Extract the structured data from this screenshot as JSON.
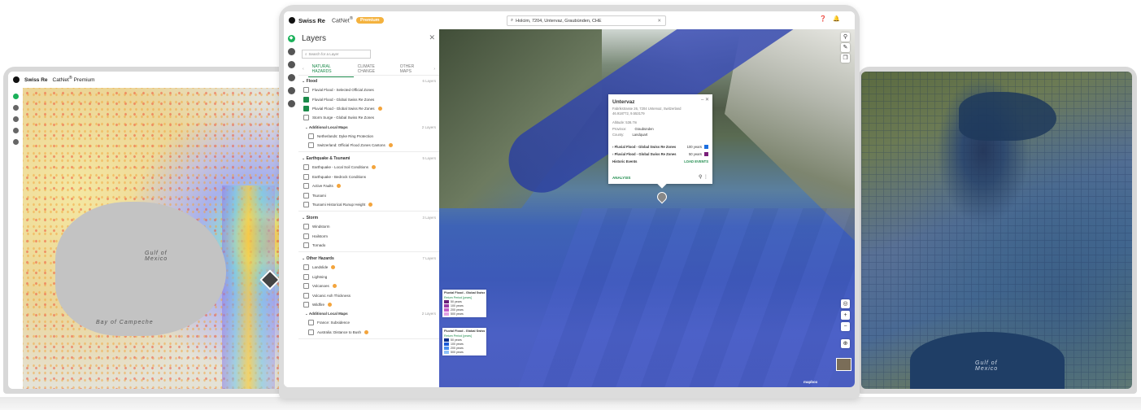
{
  "left_screen": {
    "brand": "Swiss Re",
    "product": "CatNet",
    "product_sup": "®",
    "premium": "Premium",
    "map_labels": {
      "gulf": "Gulf of\nMexico",
      "bay": "Bay of Campeche"
    }
  },
  "center_screen": {
    "brand": "Swiss Re",
    "product": "CatNet",
    "product_sup": "®",
    "premium_badge": "Premium",
    "search_value": "Holcim, 7204, Untervaz, Graubünden, CHE",
    "layers_panel": {
      "title": "Layers",
      "search_placeholder": "Search for a Layer",
      "tabs": [
        "NATURAL HAZARDS",
        "CLIMATE CHANGE",
        "OTHER MAPS"
      ],
      "categories": [
        {
          "name": "Flood",
          "count": "6 Layers",
          "items": [
            {
              "label": "Fluvial Flood - Selected Official Zones",
              "checked": false,
              "info": false
            },
            {
              "label": "Fluvial Flood - Global Swiss Re Zones",
              "checked": true,
              "info": false
            },
            {
              "label": "Pluvial Flood - Global Swiss Re Zones",
              "checked": true,
              "info": true
            },
            {
              "label": "Storm Surge - Global Swiss Re Zones",
              "checked": false,
              "info": false
            }
          ],
          "sub": {
            "name": "Additional Local Maps",
            "count": "2 Layers",
            "items": [
              {
                "label": "Netherlands: Dyke Ring Protection",
                "checked": false,
                "info": false
              },
              {
                "label": "Switzerland: Official Flood Zones Cantons",
                "checked": false,
                "info": true
              }
            ]
          }
        },
        {
          "name": "Earthquake & Tsunami",
          "count": "5 Layers",
          "items": [
            {
              "label": "Earthquake - Local Soil Conditions",
              "checked": false,
              "info": true
            },
            {
              "label": "Earthquake - Bedrock Conditions",
              "checked": false,
              "info": false
            },
            {
              "label": "Active Faults",
              "checked": false,
              "info": true
            },
            {
              "label": "Tsunami",
              "checked": false,
              "info": false
            },
            {
              "label": "Tsunami Historical Runup Height",
              "checked": false,
              "info": true
            }
          ]
        },
        {
          "name": "Storm",
          "count": "3 Layers",
          "items": [
            {
              "label": "Windstorm",
              "checked": false,
              "info": false
            },
            {
              "label": "Hailstorm",
              "checked": false,
              "info": false
            },
            {
              "label": "Tornado",
              "checked": false,
              "info": false
            }
          ]
        },
        {
          "name": "Other Hazards",
          "count": "7 Layers",
          "items": [
            {
              "label": "Landslide",
              "checked": false,
              "info": true
            },
            {
              "label": "Lightning",
              "checked": false,
              "info": false
            },
            {
              "label": "Volcanoes",
              "checked": false,
              "info": true
            },
            {
              "label": "Volcanic Ash Thickness",
              "checked": false,
              "info": false
            },
            {
              "label": "Wildfire",
              "checked": false,
              "info": true
            }
          ],
          "sub": {
            "name": "Additional Local Maps",
            "count": "2 Layers",
            "items": [
              {
                "label": "France: Subsidence",
                "checked": false,
                "info": false
              },
              {
                "label": "Australia: Distance to Bush",
                "checked": false,
                "info": true
              }
            ]
          }
        }
      ]
    },
    "popup": {
      "title": "Untervaz",
      "address": "Fabrikstrasse 26, 7204 Untervaz, Switzerland",
      "coords": "46.918772, 9.553179",
      "altitude": "Altitude: 536.7m",
      "province_label": "Province:",
      "province": "Graubünden",
      "county_label": "County:",
      "county": "Landquart",
      "rows": [
        {
          "label": "Fluvial Flood - Global Swiss Re Zones",
          "value": "100 years",
          "color": "#1d6fe0"
        },
        {
          "label": "Pluvial Flood - Global Swiss Re Zones",
          "value": "50 years",
          "color": "#7a1f7a"
        }
      ],
      "historic_label": "Historic Events",
      "historic_action": "LOAD EVENTS",
      "analysis": "ANALYSIS"
    },
    "legends": [
      {
        "title": "Pluvial Flood - Global Swiss Re Zones",
        "subtitle": "Return Period [years]",
        "entries": [
          {
            "label": "50 years",
            "color": "#6a1f78"
          },
          {
            "label": "100 years",
            "color": "#9a3aa5"
          },
          {
            "label": "200 years",
            "color": "#c45ec8"
          },
          {
            "label": "500 years",
            "color": "#e2a1e4"
          }
        ]
      },
      {
        "title": "Fluvial Flood - Global Swiss Re Zones",
        "subtitle": "Return Period [years]",
        "entries": [
          {
            "label": "50 years",
            "color": "#0b2f8a"
          },
          {
            "label": "100 years",
            "color": "#1d5ad6"
          },
          {
            "label": "200 years",
            "color": "#4a8ef0"
          },
          {
            "label": "500 years",
            "color": "#8ec0f7"
          }
        ]
      }
    ],
    "map_controls": [
      "+",
      "−"
    ],
    "attribution": "mapbox"
  },
  "right_screen": {
    "map_labels": {
      "gulf": "Gulf of\nMexico"
    }
  },
  "colors": {
    "accent_green": "#1b8a4a",
    "premium_orange": "#f4b23e",
    "info_orange": "#f3a43c"
  }
}
